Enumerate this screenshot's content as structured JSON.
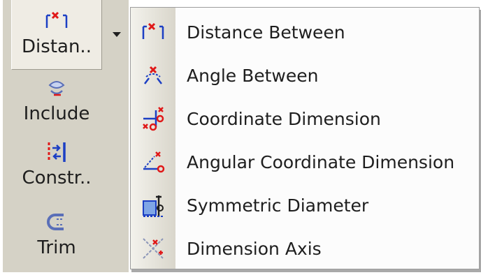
{
  "toolbar": {
    "items": [
      {
        "label": "Distan..",
        "icon": "distance-icon"
      },
      {
        "label": "Include",
        "icon": "include-icon"
      },
      {
        "label": "Constr..",
        "icon": "constraint-icon"
      },
      {
        "label": "Trim",
        "icon": "trim-icon"
      }
    ],
    "dropdown_icon": "triangle-down-icon"
  },
  "menu": {
    "items": [
      {
        "label": "Distance Between",
        "icon": "distance-between-icon"
      },
      {
        "label": "Angle Between",
        "icon": "angle-between-icon"
      },
      {
        "label": "Coordinate Dimension",
        "icon": "coordinate-dimension-icon"
      },
      {
        "label": "Angular Coordinate Dimension",
        "icon": "angular-coordinate-dimension-icon"
      },
      {
        "label": "Symmetric Diameter",
        "icon": "symmetric-diameter-icon"
      },
      {
        "label": "Dimension Axis",
        "icon": "dimension-axis-icon"
      }
    ]
  },
  "colors": {
    "toolbar_bg": "#d5d2c6",
    "icon_red": "#e01818",
    "icon_blue": "#1c3fc4",
    "menu_bg": "#fcfcfc"
  }
}
